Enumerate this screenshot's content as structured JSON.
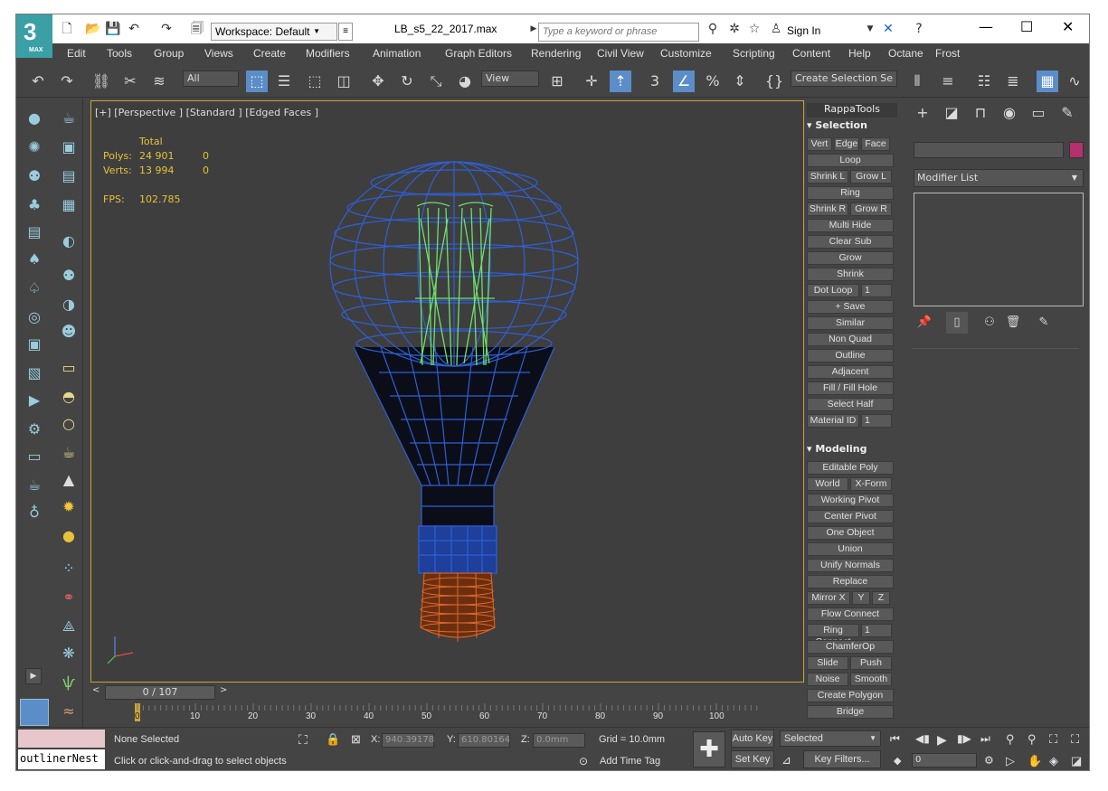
{
  "app": {
    "logo_num": "3",
    "logo_sub": "MAX"
  },
  "titlebar": {
    "workspace": "Workspace: Default",
    "filename": "LB_s5_22_2017.max",
    "search_placeholder": "Type a keyword or phrase",
    "sign_in": "Sign In"
  },
  "menu": [
    "Edit",
    "Tools",
    "Group",
    "Views",
    "Create",
    "Modifiers",
    "Animation",
    "Graph Editors",
    "Rendering",
    "Civil View",
    "Customize",
    "Scripting",
    "Content",
    "Help",
    "Octane",
    "Frost"
  ],
  "toolbar": {
    "filter": "All",
    "view": "View",
    "selection_set": "Create Selection Se"
  },
  "viewport": {
    "label": "[+] [Perspective ] [Standard ] [Edged Faces ]",
    "total_label": "Total",
    "polys_label": "Polys:",
    "polys_total": "24 901",
    "polys_sel": "0",
    "verts_label": "Verts:",
    "verts_total": "13 994",
    "verts_sel": "0",
    "fps_label": "FPS:",
    "fps": "102.785"
  },
  "timeline": {
    "frame": "0 / 107",
    "ticks": [
      "0",
      "10",
      "20",
      "30",
      "40",
      "50",
      "60",
      "70",
      "80",
      "90",
      "100"
    ]
  },
  "rappa": {
    "title": "RappaTools",
    "selection_header": "Selection",
    "modeling_header": "Modeling",
    "sel_rows": [
      [
        "Vert",
        "Edge",
        "Face"
      ],
      [
        "Loop"
      ],
      [
        "Shrink L",
        "Grow L"
      ],
      [
        "Ring"
      ],
      [
        "Shrink R",
        "Grow R"
      ],
      [
        "Multi Hide"
      ],
      [
        "Clear Sub"
      ],
      [
        "Grow"
      ],
      [
        "Shrink"
      ],
      [
        "Dot Loop",
        "1"
      ],
      [
        "+ Save"
      ],
      [
        "Similar"
      ],
      [
        "Non Quad"
      ],
      [
        "Outline"
      ],
      [
        "Adjacent"
      ],
      [
        "Fill / Fill Hole"
      ],
      [
        "Select Half"
      ],
      [
        "Material ID",
        "1"
      ]
    ],
    "mod_rows": [
      [
        "Editable Poly"
      ],
      [
        "World",
        "X-Form"
      ],
      [
        "Working Pivot"
      ],
      [
        "Center Pivot"
      ],
      [
        "One Object"
      ],
      [
        "Union"
      ],
      [
        "Unify Normals"
      ],
      [
        "Replace"
      ],
      [
        "Mirror X",
        "Y",
        "Z"
      ],
      [
        "Flow Connect"
      ],
      [
        "Ring Connect",
        "1"
      ],
      [
        "ChamferOp"
      ],
      [
        "Slide",
        "Push"
      ],
      [
        "Noise",
        "Smooth"
      ],
      [
        "Create Polygon"
      ],
      [
        "Bridge"
      ]
    ]
  },
  "cmdpanel": {
    "modifier_list": "Modifier List",
    "swatch_color": "#b5306e"
  },
  "status": {
    "outliner": "outlinerNest",
    "selection": "None Selected",
    "prompt": "Click or click-and-drag to select objects",
    "x_label": "X:",
    "x_val": "940.39178",
    "y_label": "Y:",
    "y_val": "610.80164",
    "z_label": "Z:",
    "z_val": "0.0mm",
    "grid": "Grid = 10.0mm",
    "add_time_tag": "Add Time Tag",
    "auto_key": "Auto Key",
    "set_key": "Set Key",
    "key_mode": "Selected",
    "key_filters": "Key Filters...",
    "frame_field": "0"
  },
  "colors": {
    "accent": "#5b8dc9",
    "viewport_border": "#c9a43a",
    "stats": "#e6c23a",
    "wire_blue": "#2f5fd6",
    "wire_green": "#6ee06a",
    "wire_orange": "#e0682a"
  }
}
